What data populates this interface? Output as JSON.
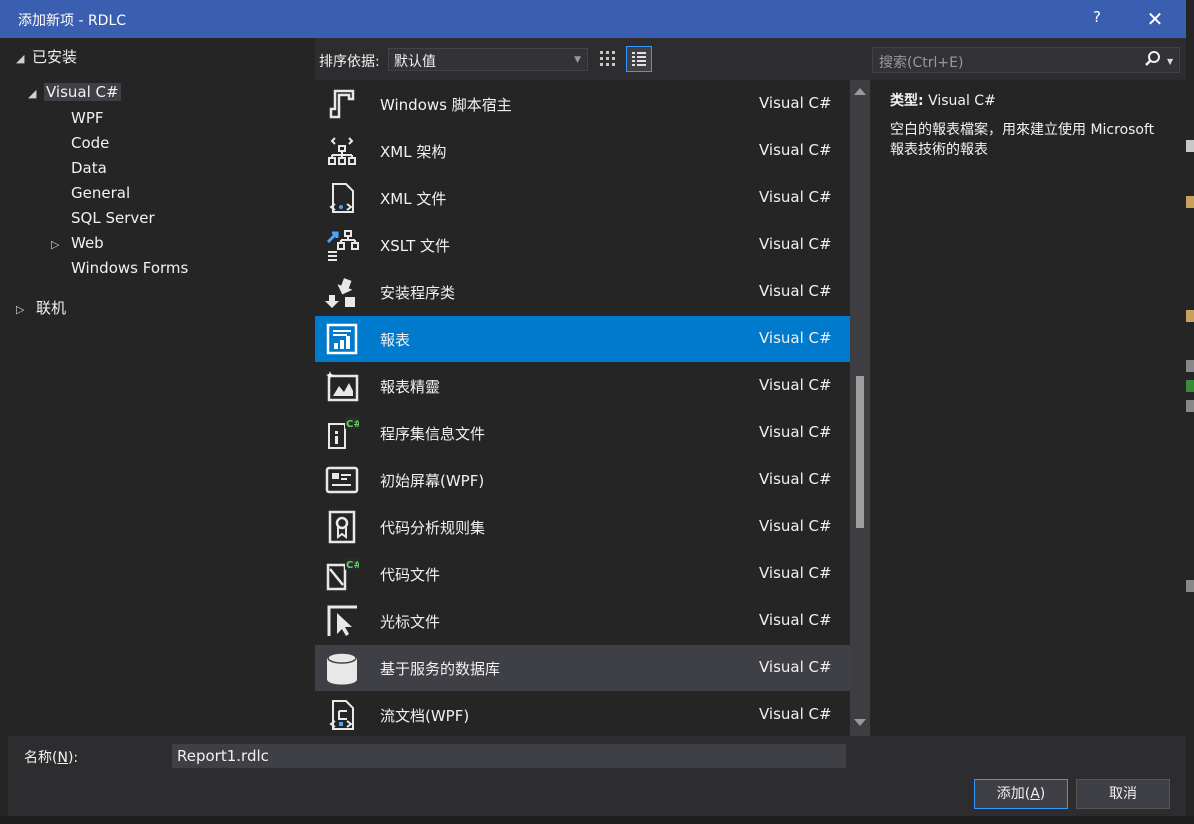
{
  "window": {
    "title": "添加新项 - RDLC",
    "help_label": "?",
    "close_label": "✕"
  },
  "tree": {
    "installed": "已安装",
    "visual_csharp": "Visual C#",
    "children": [
      "WPF",
      "Code",
      "Data",
      "General",
      "SQL Server",
      "Web",
      "Windows Forms"
    ],
    "online": "联机"
  },
  "toolbar": {
    "sort_label": "排序依据:",
    "sort_value": "默认值",
    "search_placeholder": "搜索(Ctrl+E)"
  },
  "items": [
    {
      "name": "Windows 脚本宿主",
      "lang": "Visual C#",
      "icon": "script-host-icon"
    },
    {
      "name": "XML 架构",
      "lang": "Visual C#",
      "icon": "xml-schema-icon"
    },
    {
      "name": "XML 文件",
      "lang": "Visual C#",
      "icon": "xml-file-icon"
    },
    {
      "name": "XSLT 文件",
      "lang": "Visual C#",
      "icon": "xslt-file-icon"
    },
    {
      "name": "安装程序类",
      "lang": "Visual C#",
      "icon": "installer-class-icon"
    },
    {
      "name": "報表",
      "lang": "Visual C#",
      "icon": "report-icon"
    },
    {
      "name": "報表精靈",
      "lang": "Visual C#",
      "icon": "report-wizard-icon"
    },
    {
      "name": "程序集信息文件",
      "lang": "Visual C#",
      "icon": "assembly-info-icon"
    },
    {
      "name": "初始屏幕(WPF)",
      "lang": "Visual C#",
      "icon": "splash-screen-icon"
    },
    {
      "name": "代码分析规则集",
      "lang": "Visual C#",
      "icon": "ruleset-icon"
    },
    {
      "name": "代码文件",
      "lang": "Visual C#",
      "icon": "code-file-icon"
    },
    {
      "name": "光标文件",
      "lang": "Visual C#",
      "icon": "cursor-file-icon"
    },
    {
      "name": "基于服务的数据库",
      "lang": "Visual C#",
      "icon": "database-icon"
    },
    {
      "name": "流文档(WPF)",
      "lang": "Visual C#",
      "icon": "flow-document-icon"
    }
  ],
  "selected_index": 5,
  "hover_index": 12,
  "details": {
    "type_label": "类型:",
    "type_value": "Visual C#",
    "description": "空白的報表檔案，用來建立使用 Microsoft 報表技術的報表"
  },
  "bottom": {
    "name_label_pre": "名称(",
    "name_label_key": "N",
    "name_label_post": "):",
    "name_value": "Report1.rdlc",
    "add_pre": "添加(",
    "add_key": "A",
    "add_post": ")",
    "cancel": "取消"
  },
  "colors": {
    "titlebar": "#3b5fb0",
    "selected": "#007acc",
    "background": "#2d2d30",
    "panel": "#252526"
  }
}
